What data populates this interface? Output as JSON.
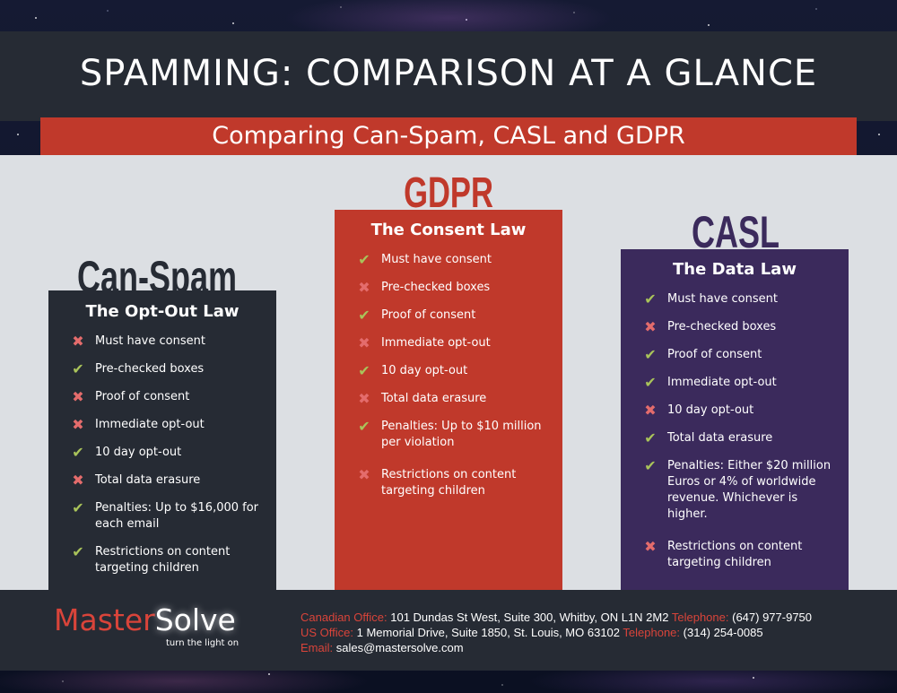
{
  "header": {
    "title": "SPAMMING: COMPARISON AT A GLANCE",
    "subtitle": "Comparing Can-Spam, CASL and GDPR"
  },
  "colors": {
    "dark_panel": "#262b34",
    "red_accent": "#c0392b",
    "purple_panel": "#3b2a5c",
    "check_green": "#a9c35a",
    "cross_red": "#e46c6c"
  },
  "icons": {
    "yes": "check-icon",
    "no": "cross-icon"
  },
  "laws": [
    {
      "name": "Can-Spam",
      "subtitle": "The Opt-Out Law",
      "items": [
        {
          "text": "Must have consent",
          "ok": false
        },
        {
          "text": "Pre-checked boxes",
          "ok": true
        },
        {
          "text": "Proof of consent",
          "ok": false
        },
        {
          "text": "Immediate opt-out",
          "ok": false
        },
        {
          "text": "10 day opt-out",
          "ok": true
        },
        {
          "text": "Total data erasure",
          "ok": false
        },
        {
          "text": "Penalties: Up to $16,000 for each email",
          "ok": true
        },
        {
          "text": "Restrictions on content targeting children",
          "ok": true
        }
      ]
    },
    {
      "name": "GDPR",
      "subtitle": "The Consent Law",
      "items": [
        {
          "text": "Must have consent",
          "ok": true
        },
        {
          "text": "Pre-checked boxes",
          "ok": false
        },
        {
          "text": "Proof of consent",
          "ok": true
        },
        {
          "text": "Immediate opt-out",
          "ok": false
        },
        {
          "text": "10 day opt-out",
          "ok": true
        },
        {
          "text": "Total data erasure",
          "ok": false
        },
        {
          "text": "Penalties: Up to $10 million per violation",
          "ok": true
        },
        {
          "text": "Restrictions on content targeting children",
          "ok": false
        }
      ]
    },
    {
      "name": "CASL",
      "subtitle": "The Data Law",
      "items": [
        {
          "text": "Must have consent",
          "ok": true
        },
        {
          "text": "Pre-checked boxes",
          "ok": false
        },
        {
          "text": "Proof of consent",
          "ok": true
        },
        {
          "text": "Immediate opt-out",
          "ok": true
        },
        {
          "text": "10 day opt-out",
          "ok": false
        },
        {
          "text": "Total data erasure",
          "ok": true
        },
        {
          "text": "Penalties: Either $20 million Euros or 4% of worldwide revenue. Whichever is higher.",
          "ok": true
        },
        {
          "text": "Restrictions on content targeting children",
          "ok": false
        }
      ]
    }
  ],
  "footer": {
    "logo_master": "Master",
    "logo_solve": "Solve",
    "tagline": "turn the light on",
    "canadian_label": "Canadian Office:",
    "canadian_address": "101 Dundas St West, Suite 300, Whitby, ON  L1N 2M2",
    "canadian_phone_label": "Telephone:",
    "canadian_phone": "(647) 977-9750",
    "us_label": "US Office:",
    "us_address": "1 Memorial Drive, Suite 1850, St. Louis, MO 63102",
    "us_phone_label": "Telephone:",
    "us_phone": "(314) 254-0085",
    "email_label": "Email:",
    "email": "sales@mastersolve.com"
  }
}
